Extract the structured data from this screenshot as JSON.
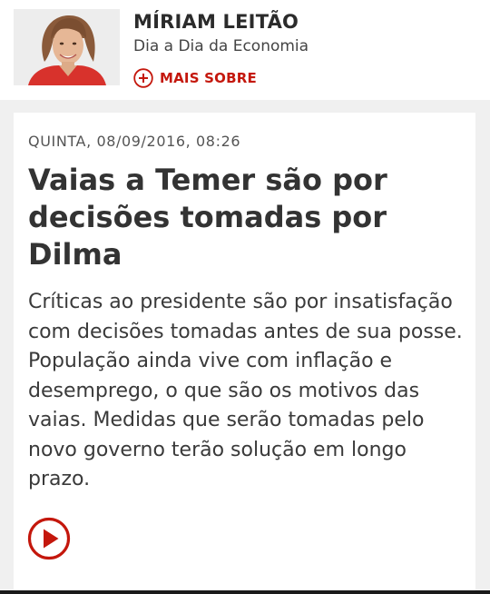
{
  "author": {
    "name": "MÍRIAM LEITÃO",
    "column": "Dia a Dia da Economia",
    "more_label": "MAIS SOBRE",
    "photo": "author-portrait"
  },
  "article": {
    "dateline": "QUINTA, 08/09/2016, 08:26",
    "headline": "Vaias a Temer são por decisões tomadas por Dilma",
    "summary": "Críticas ao presidente são por insatisfação com decisões tomadas antes de sua posse. População ainda vive com inflação e desemprego, o que são os motivos das vaias. Medidas que serão tomadas pelo novo governo terão solução em longo prazo.",
    "media_icon": "play-circle-icon"
  },
  "colors": {
    "accent": "#c4170c",
    "background": "#f0f0f0",
    "card": "#ffffff",
    "headline_text": "#333333"
  }
}
